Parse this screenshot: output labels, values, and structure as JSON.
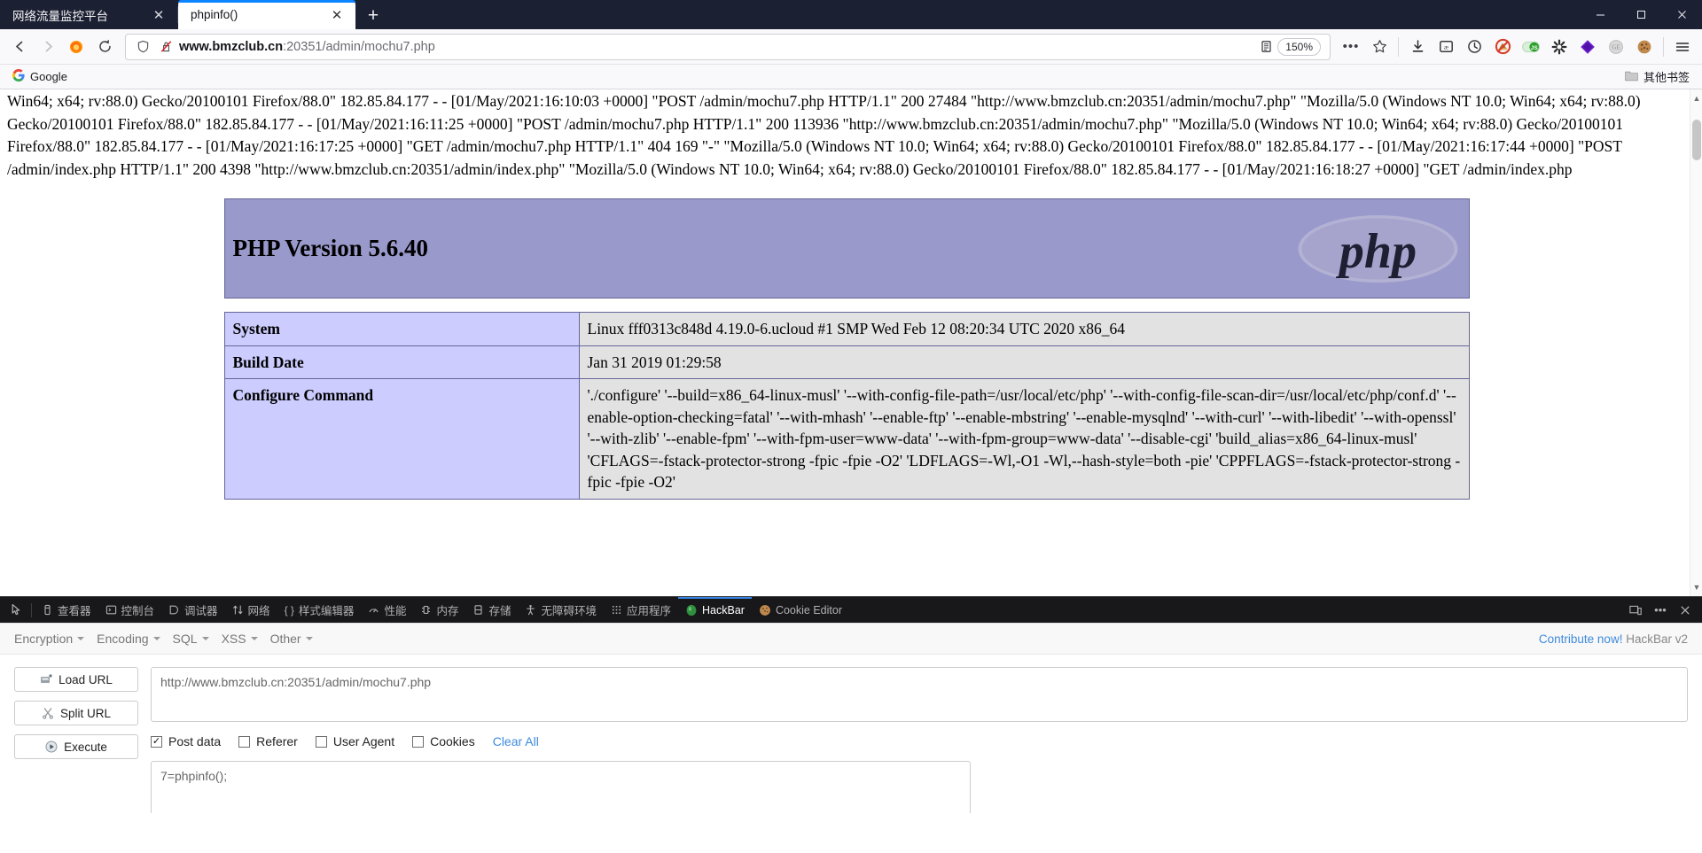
{
  "window": {
    "tabs": [
      {
        "title": "网络流量监控平台",
        "active": false
      },
      {
        "title": "phpinfo()",
        "active": true
      }
    ],
    "new_tab_label": "+",
    "close_glyph": "✕",
    "controls": {
      "minimize": "—",
      "maximize": "▢",
      "close": "✕"
    }
  },
  "nav": {
    "back": "←",
    "forward": "→",
    "reload": "⟳",
    "url_prefix": "www.bmzclub.cn",
    "url_suffix": ":20351/admin/mochu7.php",
    "zoom_level": "150%",
    "reader_icon": "reader-view-icon",
    "more_icon": "•••",
    "bookmark_icon": "☆"
  },
  "bookmarks": {
    "items": [
      {
        "label": "Google",
        "icon": "google-icon"
      }
    ],
    "other_label": "其他书签"
  },
  "page": {
    "log_text": "Win64; x64; rv:88.0) Gecko/20100101 Firefox/88.0\" 182.85.84.177 - - [01/May/2021:16:10:03 +0000] \"POST /admin/mochu7.php HTTP/1.1\" 200 27484 \"http://www.bmzclub.cn:20351/admin/mochu7.php\" \"Mozilla/5.0 (Windows NT 10.0; Win64; x64; rv:88.0) Gecko/20100101 Firefox/88.0\" 182.85.84.177 - - [01/May/2021:16:11:25 +0000] \"POST /admin/mochu7.php HTTP/1.1\" 200 113936 \"http://www.bmzclub.cn:20351/admin/mochu7.php\" \"Mozilla/5.0 (Windows NT 10.0; Win64; x64; rv:88.0) Gecko/20100101 Firefox/88.0\" 182.85.84.177 - - [01/May/2021:16:17:25 +0000] \"GET /admin/mochu7.php HTTP/1.1\" 404 169 \"-\" \"Mozilla/5.0 (Windows NT 10.0; Win64; x64; rv:88.0) Gecko/20100101 Firefox/88.0\" 182.85.84.177 - - [01/May/2021:16:17:44 +0000] \"POST /admin/index.php HTTP/1.1\" 200 4398 \"http://www.bmzclub.cn:20351/admin/index.php\" \"Mozilla/5.0 (Windows NT 10.0; Win64; x64; rv:88.0) Gecko/20100101 Firefox/88.0\" 182.85.84.177 - - [01/May/2021:16:18:27 +0000] \"GET /admin/index.php",
    "php_version": "PHP Version 5.6.40",
    "php_logo_text": "php",
    "table": [
      {
        "key": "System",
        "value": "Linux fff0313c848d 4.19.0-6.ucloud #1 SMP Wed Feb 12 08:20:34 UTC 2020 x86_64"
      },
      {
        "key": "Build Date",
        "value": "Jan 31 2019 01:29:58"
      },
      {
        "key": "Configure Command",
        "value": "'./configure' '--build=x86_64-linux-musl' '--with-config-file-path=/usr/local/etc/php' '--with-config-file-scan-dir=/usr/local/etc/php/conf.d' '--enable-option-checking=fatal' '--with-mhash' '--enable-ftp' '--enable-mbstring' '--enable-mysqlnd' '--with-curl' '--with-libedit' '--with-openssl' '--with-zlib' '--enable-fpm' '--with-fpm-user=www-data' '--with-fpm-group=www-data' '--disable-cgi' 'build_alias=x86_64-linux-musl' 'CFLAGS=-fstack-protector-strong -fpic -fpie -O2' 'LDFLAGS=-Wl,-O1 -Wl,--hash-style=both -pie' 'CPPFLAGS=-fstack-protector-strong -fpic -fpie -O2'"
      }
    ]
  },
  "devtools": {
    "picker_icon": "element-picker-icon",
    "tabs": [
      {
        "label": "查看器",
        "icon": "inspector-icon",
        "active": false
      },
      {
        "label": "控制台",
        "icon": "console-icon",
        "active": false
      },
      {
        "label": "调试器",
        "icon": "debugger-icon",
        "active": false
      },
      {
        "label": "网络",
        "icon": "network-icon",
        "active": false
      },
      {
        "label": "样式编辑器",
        "icon": "style-editor-icon",
        "active": false
      },
      {
        "label": "性能",
        "icon": "performance-icon",
        "active": false
      },
      {
        "label": "内存",
        "icon": "memory-icon",
        "active": false
      },
      {
        "label": "存储",
        "icon": "storage-icon",
        "active": false
      },
      {
        "label": "无障碍环境",
        "icon": "accessibility-icon",
        "active": false
      },
      {
        "label": "应用程序",
        "icon": "application-icon",
        "active": false
      },
      {
        "label": "HackBar",
        "icon": "hackbar-icon",
        "active": true
      },
      {
        "label": "Cookie Editor",
        "icon": "cookie-icon",
        "active": false
      }
    ],
    "right_icons": [
      "responsive-design-icon",
      "meatball-menu-icon",
      "close-icon"
    ]
  },
  "hackbar": {
    "menus": [
      {
        "label": "Encryption"
      },
      {
        "label": "Encoding"
      },
      {
        "label": "SQL"
      },
      {
        "label": "XSS"
      },
      {
        "label": "Other"
      }
    ],
    "contribute_link": "Contribute now!",
    "version_label": "HackBar v2",
    "buttons": [
      {
        "label": "Load URL",
        "icon": "load-url-icon"
      },
      {
        "label": "Split URL",
        "icon": "split-url-icon"
      },
      {
        "label": "Execute",
        "icon": "execute-icon"
      }
    ],
    "url_value": "http://www.bmzclub.cn:20351/admin/mochu7.php",
    "checkboxes": [
      {
        "label": "Post data",
        "checked": true
      },
      {
        "label": "Referer",
        "checked": false
      },
      {
        "label": "User Agent",
        "checked": false
      },
      {
        "label": "Cookies",
        "checked": false
      }
    ],
    "clear_all": "Clear All",
    "post_value": "7=phpinfo();"
  },
  "colors": {
    "tabstrip_bg": "#1c2033",
    "accent_blue": "#0a84ff",
    "php_header": "#9999cc",
    "php_key": "#ccccff",
    "php_value": "#e2e2e2",
    "devtools_bg": "#18181b",
    "link_blue": "#3d8bdd"
  }
}
